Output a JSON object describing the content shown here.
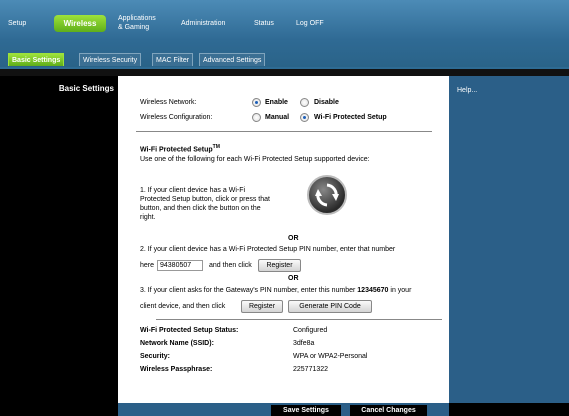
{
  "nav": {
    "setup": "Setup",
    "wireless": "Wireless",
    "applications_line1": "Applications",
    "applications_line2": "& Gaming",
    "administration": "Administration",
    "status": "Status",
    "logoff": "Log OFF"
  },
  "tabs": {
    "basic": "Basic Settings",
    "security": "Wireless Security",
    "mac": "MAC Filter",
    "advanced": "Advanced Settings"
  },
  "sidebar": {
    "title": "Basic Settings"
  },
  "help": {
    "label": "Help..."
  },
  "form": {
    "network_label": "Wireless Network:",
    "enable": "Enable",
    "disable": "Disable",
    "network_selected": "Enable",
    "config_label": "Wireless Configuration:",
    "manual": "Manual",
    "wps": "Wi-Fi Protected Setup",
    "config_selected": "Wi-Fi Protected Setup"
  },
  "wps": {
    "title": "Wi-Fi Protected Setup",
    "tm": "TM",
    "intro": "Use one of the following for each Wi-Fi Protected Setup supported device:",
    "step1_line1": "1. If your client device has a Wi-Fi",
    "step1_line2": "Protected Setup button, click or press that",
    "step1_line3": "button, and then click the button on the",
    "step1_line4": "right.",
    "or1": "OR",
    "step2_line1": "2. If your client device has a Wi-Fi Protected Setup PIN number, enter that number",
    "step2_here": "here",
    "pin_value": "94380507",
    "step2_then": "and then click",
    "register1": "Register",
    "or2": "OR",
    "step3_prefix": "3. If your client asks for the Gateway's PIN number, enter this number",
    "gateway_pin": "12345670",
    "step3_in": "in your",
    "step3_line2": "client device, and then click",
    "register2": "Register",
    "generate": "Generate PIN Code"
  },
  "status": {
    "wps_status_label": "Wi-Fi Protected Setup Status:",
    "wps_status_value": "Configured",
    "ssid_label": "Network Name (SSID):",
    "ssid_value": "3dfe8a",
    "security_label": "Security:",
    "security_value": "WPA or WPA2-Personal",
    "pass_label": "Wireless Passphrase:",
    "pass_value": "225771322"
  },
  "footer": {
    "save": "Save Settings",
    "cancel": "Cancel Changes"
  }
}
